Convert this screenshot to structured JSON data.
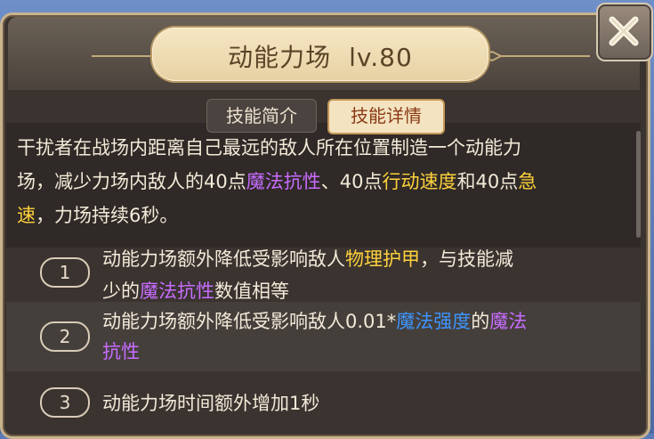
{
  "skill": {
    "name": "动能力场",
    "level": "lv.80"
  },
  "tabs": {
    "intro": "技能简介",
    "detail": "技能详情"
  },
  "description": {
    "line1": "干扰者在战场内距离自己最远的敌人所在位置制造一个动能力",
    "line2_a": "场，减少力场内敌人的40点",
    "line2_magic": "魔法抗性",
    "line2_b": "、40点",
    "line2_speed": "行动速度",
    "line2_c": "和40点",
    "line2_haste": "急",
    "line3_haste": "速",
    "line3_rest": "，力场持续6秒。"
  },
  "upgrades": [
    {
      "number": "1",
      "l1_a": "动能力场额外降低受影响敌人",
      "l1_gold": "物理护甲",
      "l1_b": "，与技能减",
      "l2_a": "少的",
      "l2_magic": "魔法抗性",
      "l2_b": "数值相等"
    },
    {
      "number": "2",
      "l1_a": "动能力场额外降低受影响敌人0.01*",
      "l1_blue": "魔法强度",
      "l1_b": "的",
      "l1_magic": "魔法",
      "l2_magic": "抗性"
    },
    {
      "number": "3",
      "l1_a": "动能力场时间额外增加1秒"
    }
  ],
  "colors": {
    "magic": "#c86cff",
    "gold": "#ffd23c",
    "blue": "#3d95ff"
  },
  "icons": {
    "close": "close-icon"
  }
}
